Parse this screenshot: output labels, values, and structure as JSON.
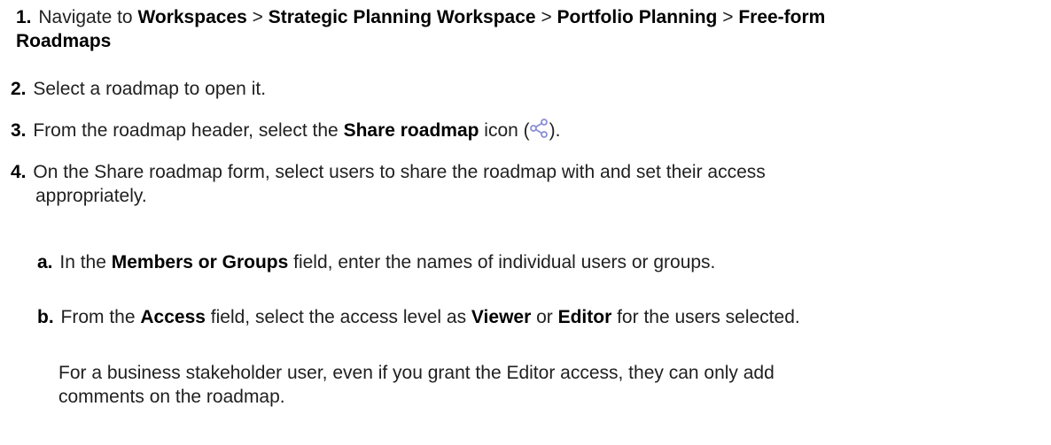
{
  "steps": [
    {
      "num": "1.",
      "pre": "Navigate to ",
      "path": [
        "Workspaces",
        "Strategic Planning Workspace",
        "Portfolio Planning",
        "Free-form"
      ],
      "sep": " > ",
      "wrap": "Roadmaps"
    },
    {
      "num": "2.",
      "text": "Select a roadmap to open it."
    },
    {
      "num": "3.",
      "pre": "From the roadmap header, select the ",
      "bold": "Share roadmap",
      "post": " icon (",
      "close": ").",
      "icon": "share-icon"
    },
    {
      "num": "4.",
      "line1": "On the Share roadmap form, select users to share the roadmap with and set their access",
      "line2": "appropriately."
    }
  ],
  "substeps": [
    {
      "num": "a.",
      "pre": "In the ",
      "bold": "Members or Groups",
      "post": " field, enter the names of individual users or groups."
    },
    {
      "num": "b.",
      "pre": "From the ",
      "bold1": "Access",
      "mid1": " field, select the access level as ",
      "bold2": "Viewer",
      "mid2": " or ",
      "bold3": "Editor",
      "post": " for the users selected."
    }
  ],
  "note": {
    "line1": "For a business stakeholder user, even if you grant the Editor access, they can only add",
    "line2": "comments on the roadmap."
  },
  "colors": {
    "text": "#1f1f1f",
    "icon": "#8a8fd6"
  }
}
